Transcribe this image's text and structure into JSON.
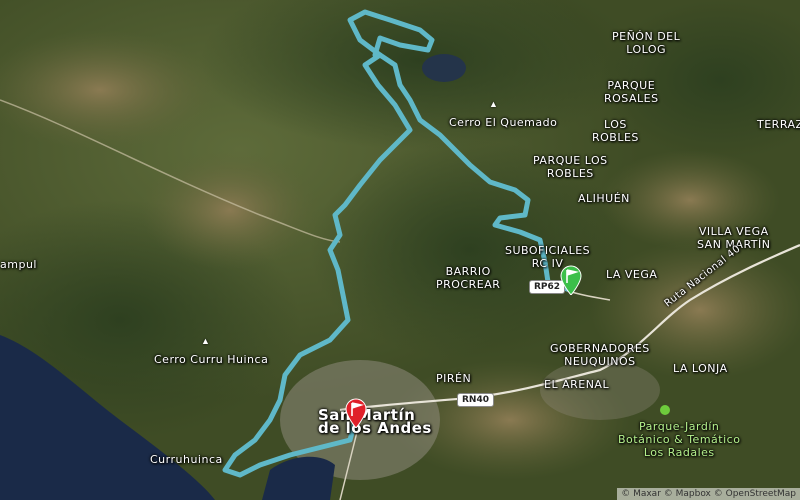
{
  "map": {
    "labels": {
      "penon": "PEÑÓN DEL\nLOLOG",
      "parque_rosales": "PARQUE\nROSALES",
      "cerro_quemado": "Cerro El Quemado",
      "los_robles": "LOS\nROBLES",
      "parque_los_robles": "PARQUE LOS\nROBLES",
      "terraz": "TERRAZ",
      "alihuen": "ALIHUÉN",
      "villa_vega": "VILLA VEGA\nSAN MARTÍN",
      "suboficiales": "SUBOFICIALES\nRC IV",
      "barrio_procrear": "BARRIO\nPROCREAR",
      "la_vega": "LA VEGA",
      "ruta40": "Ruta Nacional 40",
      "ampul": "ampul",
      "cerro_curru": "Cerro Curru Huinca",
      "gobernadores": "GOBERNADORES\nNEUQUINOS",
      "la_lonja": "LA LONJA",
      "piren": "PIRÉN",
      "el_arenal": "EL ARENAL",
      "san_martin": "San Martín\nde los Andes",
      "parque_jardin": "Parque-Jardín\nBotánico & Temático\nLos Radales",
      "curruhuinca": "Curruhuinca"
    },
    "shields": {
      "rp62": "RP62",
      "rn40": "RN40"
    },
    "attribution": "© Maxar © Mapbox © OpenStreetMap",
    "colors": {
      "route": "#5fb8c8",
      "start_flag": "#3cbf4a",
      "end_flag": "#e0202a",
      "lake": "#1a2a48"
    }
  }
}
